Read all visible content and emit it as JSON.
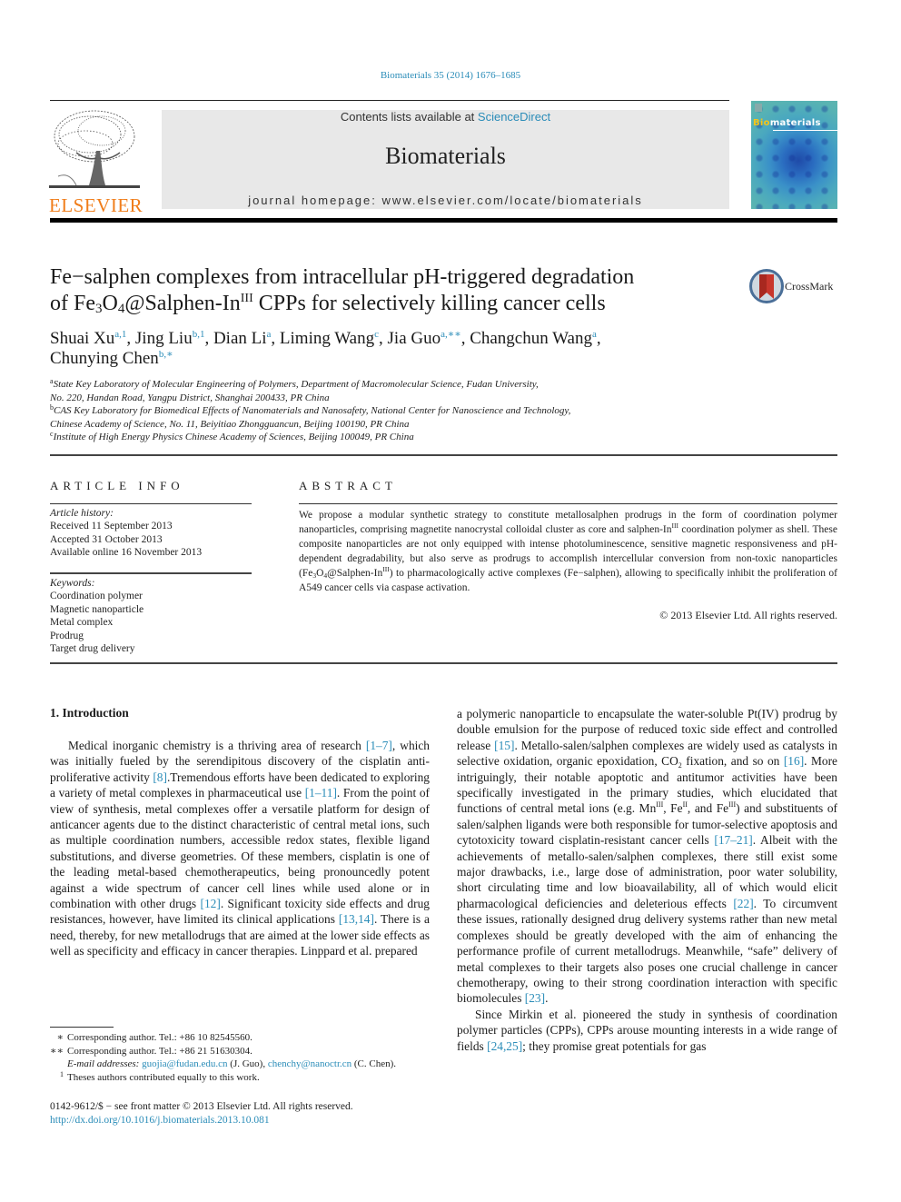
{
  "header": {
    "journal_ref": "Biomaterials 35 (2014) 1676–1685",
    "contents_prefix": "Contents lists available at ",
    "contents_link": "ScienceDirect",
    "journal_name": "Biomaterials",
    "homepage": "journal homepage: www.elsevier.com/locate/biomaterials",
    "publisher_logo": "ELSEVIER",
    "cover_title_prefix": "Bio",
    "cover_title_suffix": "materials",
    "crossmark": "CrossMark"
  },
  "article": {
    "title_line1": "Fe−salphen complexes from intracellular pH-triggered degradation",
    "title_line2_a": "of Fe",
    "title_line2_sub1": "3",
    "title_line2_b": "O",
    "title_line2_sub2": "4",
    "title_line2_c": "@Salphen-In",
    "title_line2_sup": "III",
    "title_line2_d": " CPPs for selectively killing cancer cells",
    "authors": [
      {
        "name": "Shuai Xu",
        "marks": "a,1",
        "sep": ", "
      },
      {
        "name": "Jing Liu",
        "marks": "b,1",
        "sep": ", "
      },
      {
        "name": "Dian Li",
        "marks": "a",
        "sep": ", "
      },
      {
        "name": "Liming Wang",
        "marks": "c",
        "sep": ", "
      },
      {
        "name": "Jia Guo",
        "marks": "a,∗∗",
        "sep": ", "
      },
      {
        "name": "Changchun Wang",
        "marks": "a",
        "sep": ","
      },
      {
        "name": "Chunying Chen",
        "marks": "b,∗",
        "sep": ""
      }
    ],
    "affiliations": [
      {
        "mark": "a",
        "line1": "State Key Laboratory of Molecular Engineering of Polymers, Department of Macromolecular Science, Fudan University,",
        "line2": "No. 220, Handan Road, Yangpu District, Shanghai 200433, PR China"
      },
      {
        "mark": "b",
        "line1": "CAS Key Laboratory for Biomedical Effects of Nanomaterials and Nanosafety, National Center for Nanoscience and Technology,",
        "line2": "Chinese Academy of Science, No. 11, Beiyitiao Zhongguancun, Beijing 100190, PR China"
      },
      {
        "mark": "c",
        "line1": "Institute of High Energy Physics Chinese Academy of Sciences, Beijing 100049, PR China",
        "line2": ""
      }
    ]
  },
  "article_info": {
    "heading": "ARTICLE INFO",
    "history_label": "Article history:",
    "received": "Received 11 September 2013",
    "accepted": "Accepted 31 October 2013",
    "online": "Available online 16 November 2013",
    "keywords_label": "Keywords:",
    "keywords": [
      "Coordination polymer",
      "Magnetic nanoparticle",
      "Metal complex",
      "Prodrug",
      "Target drug delivery"
    ]
  },
  "abstract": {
    "heading": "ABSTRACT",
    "p1": "We propose a modular synthetic strategy to constitute metallosalphen prodrugs in the form of coordination polymer nanoparticles, comprising magnetite nanocrystal colloidal cluster as core and salphen-In",
    "p1_sup": "III",
    "p2": " coordination polymer as shell. These composite nanoparticles are not only equipped with intense photoluminescence, sensitive magnetic responsiveness and pH-dependent degradability, but also serve as prodrugs to accomplish intercellular conversion from non-toxic nanoparticles (Fe",
    "p2_sub1": "3",
    "p2_o": "O",
    "p2_sub2": "4",
    "p2_b": "@Salphen-In",
    "p2_sup": "III",
    "p3": ") to pharmacologically active complexes (Fe−salphen), allowing to specifically inhibit the proliferation of A549 cancer cells via caspase activation.",
    "copyright": "© 2013 Elsevier Ltd. All rights reserved."
  },
  "introduction": {
    "heading": "1.  Introduction",
    "left": {
      "t1": "Medical inorganic chemistry is a thriving area of research ",
      "r1": "[1–7]",
      "t2": ", which was initially fueled by the serendipitous discovery of the cisplatin anti-proliferative activity ",
      "r2": "[8]",
      "t3": ".Tremendous efforts have been dedicated to exploring a variety of metal complexes in pharmaceutical use ",
      "r3": "[1–11]",
      "t4": ". From the point of view of synthesis, metal complexes offer a versatile platform for design of anticancer agents due to the distinct characteristic of central metal ions, such as multiple coordination numbers, accessible redox states, flexible ligand substitutions, and diverse geometries. Of these members, cisplatin is one of the leading metal-based chemotherapeutics, being pronouncedly potent against a wide spectrum of cancer cell lines while used alone or in combination with other drugs ",
      "r4": "[12]",
      "t5": ". Significant toxicity side effects and drug resistances, however, have limited its clinical applications ",
      "r5": "[13,14]",
      "t6": ". There is a need, thereby, for new metallodrugs that are aimed at the lower side effects as well as specificity and efficacy in cancer therapies. Linppard et al. prepared"
    },
    "right": {
      "t1": "a polymeric nanoparticle to encapsulate the water-soluble Pt(IV) prodrug by double emulsion for the purpose of reduced toxic side effect and controlled release ",
      "r1": "[15]",
      "t2": ". Metallo-salen/salphen complexes are widely used as catalysts in selective oxidation, organic epoxidation, CO",
      "t2_sub": "2",
      "t3": " fixation, and so on ",
      "r2": "[16]",
      "t4": ". More intriguingly, their notable apoptotic and antitumor activities have been specifically investigated in the primary studies, which elucidated that functions of central metal ions (e.g. Mn",
      "sup1": "III",
      "t5": ", Fe",
      "sup2": "II",
      "t6": ", and Fe",
      "sup3": "III",
      "t7": ") and substituents of salen/salphen ligands were both responsible for tumor-selective apoptosis and cytotoxicity toward cisplatin-resistant cancer cells ",
      "r3": "[17–21]",
      "t8": ". Albeit with the achievements of metallo-salen/salphen complexes, there still exist some major drawbacks, i.e., large dose of administration, poor water solubility, short circulating time and low bioavailability, all of which would elicit pharmacological deficiencies and deleterious effects ",
      "r4": "[22]",
      "t9": ". To circumvent these issues, rationally designed drug delivery systems rather than new metal complexes should be greatly developed with the aim of enhancing the performance profile of current metallodrugs. Meanwhile, “safe” delivery of metal complexes to their targets also poses one crucial challenge in cancer chemotherapy, owing to their strong coordination interaction with specific biomolecules ",
      "r5": "[23]",
      "t10": ".",
      "p2_t1": "Since Mirkin et al. pioneered the study in synthesis of coordination polymer particles (CPPs), CPPs arouse mounting interests in a wide range of fields ",
      "p2_r1": "[24,25]",
      "p2_t2": "; they promise great potentials for gas"
    }
  },
  "footnotes": {
    "fn1_mark": "∗",
    "fn1": "Corresponding author. Tel.: +86 10 82545560.",
    "fn2_mark": "∗∗",
    "fn2": "Corresponding author. Tel.: +86 21 51630304.",
    "email_label": "E-mail addresses:",
    "email1": "guojia@fudan.edu.cn",
    "email1_who": " (J. Guo), ",
    "email2": "chenchy@nanoctr.cn",
    "email2_who": " (C. Chen).",
    "fn3_mark": "1",
    "fn3": "Theses authors contributed equally to this work."
  },
  "front_matter": {
    "issn_line": "0142-9612/$ − see front matter © 2013 Elsevier Ltd. All rights reserved.",
    "doi": "http://dx.doi.org/10.1016/j.biomaterials.2013.10.081"
  },
  "colors": {
    "link": "#2a8cb8",
    "elsevier_orange": "#f07d1a",
    "masthead_bg": "#e8e8e8"
  }
}
